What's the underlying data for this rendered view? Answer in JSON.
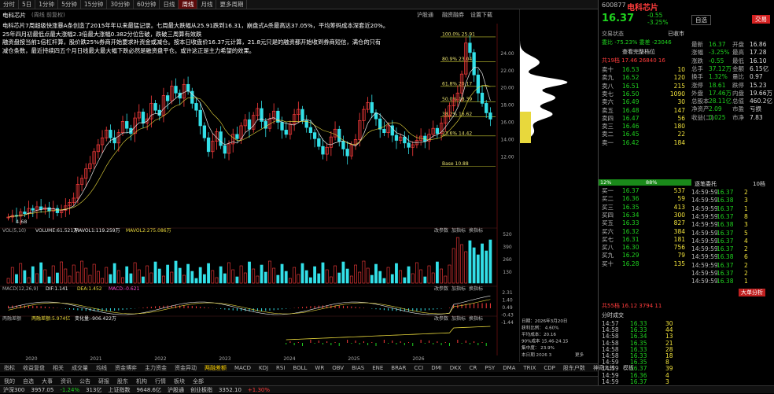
{
  "toolbar": {
    "items": [
      "分时",
      "5日",
      "1分钟",
      "5分钟",
      "15分钟",
      "30分钟",
      "60分钟",
      "日线",
      "周线",
      "月线",
      "更多周期"
    ],
    "active": "周线"
  },
  "chart_header": {
    "name": "电科芯片",
    "note": "(周线 前复权)",
    "right_a": "沪股通",
    "right_b": "融资融券",
    "right_c": "设置下载"
  },
  "annotation": [
    "电科芯片7周超级快涨暴A条创造了2015年年以来最猛记录。七周最大跌幅从25.91跌到16.31，崩盘式A杀最高达37.05%，平均筹码成本深套近20%。",
    "25年四月初最低点最大涨幅2.3倍最大涨幅0.382分位告破，跌破三周算有效跌",
    "融资盘按当前1倍杠杆算，股价跌25%券商开始要求补资金或减仓。按本日收盘价16.37元计算，21.8元只是的融资都开始收到券商短信，满仓的只有",
    "减仓条数，最近持续四五个月日线最大最大幅下跌必然是融资盘平仓。或许这正是主力希望的效果。"
  ],
  "fib": [
    {
      "label": "100.0% 25.91",
      "price": 25.91
    },
    {
      "label": "80.9% 23.04",
      "price": 23.04
    },
    {
      "label": "61.8% 20.17",
      "price": 20.17
    },
    {
      "label": "50.0% 18.39",
      "price": 18.39
    },
    {
      "label": "38.2% 16.62",
      "price": 16.62
    },
    {
      "label": "23.6% 14.42",
      "price": 14.42
    },
    {
      "label": "Base 10.88",
      "price": 10.88
    }
  ],
  "price_axis": [
    "24.00",
    "22.00",
    "20.00",
    "18.00",
    "16.00",
    "14.00",
    "12.00"
  ],
  "chart_data": {
    "type": "line",
    "low_label": "4.68",
    "x_ticks": [
      "2020",
      "2021",
      "2022",
      "2023",
      "2024",
      "2025",
      "2026"
    ],
    "weekly_close": [
      5.0,
      5.2,
      5.1,
      5.6,
      5.4,
      6.0,
      5.8,
      6.2,
      5.9,
      6.1,
      5.7,
      6.0,
      5.5,
      5.8,
      6.3,
      6.7,
      7.2,
      8.8,
      9.5,
      10.6,
      11.2,
      12.6,
      13.4,
      14.2,
      15.1,
      14.2,
      13.6,
      14.8,
      16.1,
      15.3,
      14.7,
      16.5,
      17.2,
      15.9,
      16.4,
      18.2,
      17.4,
      16.8,
      19.1,
      18.5,
      20.2,
      19.4,
      18.8,
      20.4,
      19.6,
      18.2,
      17.4,
      15.6,
      14.2,
      12.6,
      13.8,
      14.9,
      13.3,
      12.4,
      13.5,
      14.6,
      14.1,
      15.6,
      16.3,
      15.2,
      16.8,
      17.6,
      16.1,
      15.3,
      16.4,
      17.3,
      16.0,
      15.1,
      14.6,
      15.8,
      16.9,
      17.5,
      16.2,
      15.4,
      14.8,
      14.1,
      13.2,
      12.3,
      13.1,
      14.3,
      15.2,
      13.8,
      12.9,
      12.1,
      13.4,
      14.0,
      16.2,
      17.5,
      18.3,
      17.1,
      16.4,
      15.2,
      14.8,
      15.6,
      14.5,
      13.9,
      14.3,
      13.6,
      13.1,
      13.4,
      13.9,
      14.4,
      13.8,
      14.6,
      15.3,
      14.7,
      15.9,
      16.7,
      17.9,
      18.6,
      19.4,
      21.6,
      25.2,
      24.1,
      21.5,
      19.4,
      18.2,
      17.1,
      16.37
    ],
    "volume": {
      "label": "VOL(5,10)",
      "vol": "VOLUME:61.521万",
      "mavol1": "MAVOL1:119.259万",
      "mavol2": "MAVOL2:275.086万",
      "axis": [
        "520",
        "390",
        "260",
        "130"
      ]
    },
    "macd": {
      "label": "MACD(12,26,9)",
      "dif": "DIF:1.141",
      "dea": "DEA:1.452",
      "macd": "MACD:-0.621",
      "axis": [
        "2.31",
        "1.40",
        "0.49",
        "-0.43",
        "-1.44"
      ]
    },
    "fund": {
      "label": "两融差额",
      "value": "两融差额:5.974亿",
      "change": "变化量:-906.422万"
    }
  },
  "sub_btns": [
    "改参数",
    "加指标",
    "换指标"
  ],
  "info_box": {
    "date": "日期：2026年3月20日",
    "profit": "获利比例：",
    "profit_val": "4.60%",
    "avg": "平均成本：20.16",
    "avg_val": "",
    "range": "90%成本",
    "range_val": "15.46-24.15",
    "conc": "集中度：",
    "conc_val": "23.9%",
    "bot_label": "本日期",
    "bot_val": "2026 3",
    "more": "更多"
  },
  "bottom_tabs": [
    "指标",
    "收益复盘",
    "相关",
    "成交量",
    "均线",
    "资金博弈",
    "主力资金",
    "资金异动",
    "两融差额",
    "MACD",
    "KDJ",
    "RSI",
    "BOLL",
    "WR",
    "OBV",
    "BIAS",
    "ENE",
    "BRAR",
    "CCI",
    "DMI",
    "DKX",
    "CR",
    "PSY",
    "DMA",
    "TRIX",
    "CDP",
    "股东户数",
    "神奇九转",
    "模板"
  ],
  "bottom_active": "两融差额",
  "quote": {
    "code": "600877",
    "name": "电科芯片",
    "price": "16.37",
    "chg": "-0.55",
    "pct": "-3.25%",
    "btn_self": "自选",
    "btn_trade": "交易"
  },
  "quote_rows": [
    [
      "最新",
      "16.37",
      "开盘",
      "16.86"
    ],
    [
      "涨幅",
      "-3.25%",
      "最高",
      "17.28"
    ],
    [
      "涨跌",
      "-0.55",
      "最低",
      "16.10"
    ],
    [
      "总手",
      "37.12万",
      "金额",
      "6.15亿"
    ],
    [
      "换手",
      "1.32%",
      "量比",
      "0.97"
    ],
    [
      "涨停",
      "18.61",
      "跌停",
      "15.23"
    ],
    [
      "外盘",
      "17.46万",
      "内盘",
      "19.66万"
    ],
    [
      "总股本",
      "28.11亿",
      "总值",
      "460.2亿"
    ],
    [
      "净资产",
      "2.09",
      "市盈",
      "亏损"
    ],
    [
      "收益(二)",
      "0.025",
      "市净",
      "7.83"
    ]
  ],
  "order_sell": [
    [
      "卖十",
      "16.53",
      "10"
    ],
    [
      "卖九",
      "16.52",
      "120"
    ],
    [
      "卖八",
      "16.51",
      "215"
    ],
    [
      "卖七",
      "16.50",
      "1090"
    ],
    [
      "卖六",
      "16.49",
      "30"
    ],
    [
      "卖五",
      "16.48",
      "147"
    ],
    [
      "卖四",
      "16.47",
      "56"
    ],
    [
      "卖三",
      "16.46",
      "180"
    ],
    [
      "卖二",
      "16.45",
      "22"
    ],
    [
      "卖一",
      "16.42",
      "184"
    ]
  ],
  "order_buy": [
    [
      "买一",
      "16.37",
      "537"
    ],
    [
      "买二",
      "16.36",
      "59"
    ],
    [
      "买三",
      "16.35",
      "413"
    ],
    [
      "买四",
      "16.34",
      "300"
    ],
    [
      "买五",
      "16.33",
      "827"
    ],
    [
      "买六",
      "16.32",
      "384"
    ],
    [
      "买七",
      "16.31",
      "181"
    ],
    [
      "买八",
      "16.30",
      "756"
    ],
    [
      "买九",
      "16.29",
      "79"
    ],
    [
      "买十",
      "16.28",
      "135"
    ]
  ],
  "trades": [
    [
      "14:59:59",
      "16.37",
      "2"
    ],
    [
      "14:59:59",
      "16.38",
      "3"
    ],
    [
      "14:59:59",
      "16.37",
      "1"
    ],
    [
      "14:59:59",
      "16.37",
      "8"
    ],
    [
      "14:59:59",
      "16.38",
      "3"
    ],
    [
      "14:59:59",
      "16.37",
      "5"
    ],
    [
      "14:59:59",
      "16.37",
      "4"
    ],
    [
      "14:59:59",
      "16.37",
      "2"
    ],
    [
      "14:59:59",
      "16.38",
      "6"
    ],
    [
      "14:59:59",
      "16.37",
      "2"
    ],
    [
      "14:59:59",
      "16.37",
      "2"
    ],
    [
      "14:59:59",
      "16.38",
      "1"
    ]
  ],
  "minute_trades": [
    [
      "14:57",
      "16.33",
      "30"
    ],
    [
      "14:58",
      "16.33",
      "44"
    ],
    [
      "14:58",
      "16.34",
      "13"
    ],
    [
      "14:58",
      "16.35",
      "21"
    ],
    [
      "14:58",
      "16.33",
      "28"
    ],
    [
      "14:58",
      "16.33",
      "18"
    ],
    [
      "14:59",
      "16.35",
      "8"
    ],
    [
      "14:59",
      "16.37",
      "39"
    ],
    [
      "14:59",
      "16.36",
      "4"
    ],
    [
      "14:59",
      "16.37",
      "3"
    ]
  ],
  "labels": {
    "traded": "交易状态",
    "traded_val": "已收市",
    "weibi": "委比",
    "weibi_val": "-75.23%",
    "weicha": "委差",
    "weicha_val": "-23046",
    "sum_top": "共19档",
    "sum_top_a": "17.46",
    "sum_top_b": "26840",
    "sum_top_c": "16",
    "sum_bot": "共55档",
    "sum_bot_a": "16.12",
    "sum_bot_b": "3794",
    "sum_bot_c": "11",
    "pct_bar": "12%",
    "pct_bar2": "88%",
    "fentime": "分时成交",
    "bigtrades": "逐笔委托",
    "daitrade": "大单分析",
    "full": "查看完整档位",
    "shuangjia": "10档"
  },
  "status": [
    [
      "沪深300",
      "3957.05",
      "-1.24%",
      "313亿"
    ],
    [
      "上证指数",
      "9648.6亿",
      "",
      "沪股通"
    ],
    [
      "创业板指",
      "3352.10",
      "+1.30%",
      ""
    ]
  ],
  "fund_tabs": [
    "我的",
    "自选",
    "大事",
    "资讯",
    "公告",
    "研报",
    "股东",
    "机构",
    "行情",
    "板块",
    "全部"
  ]
}
